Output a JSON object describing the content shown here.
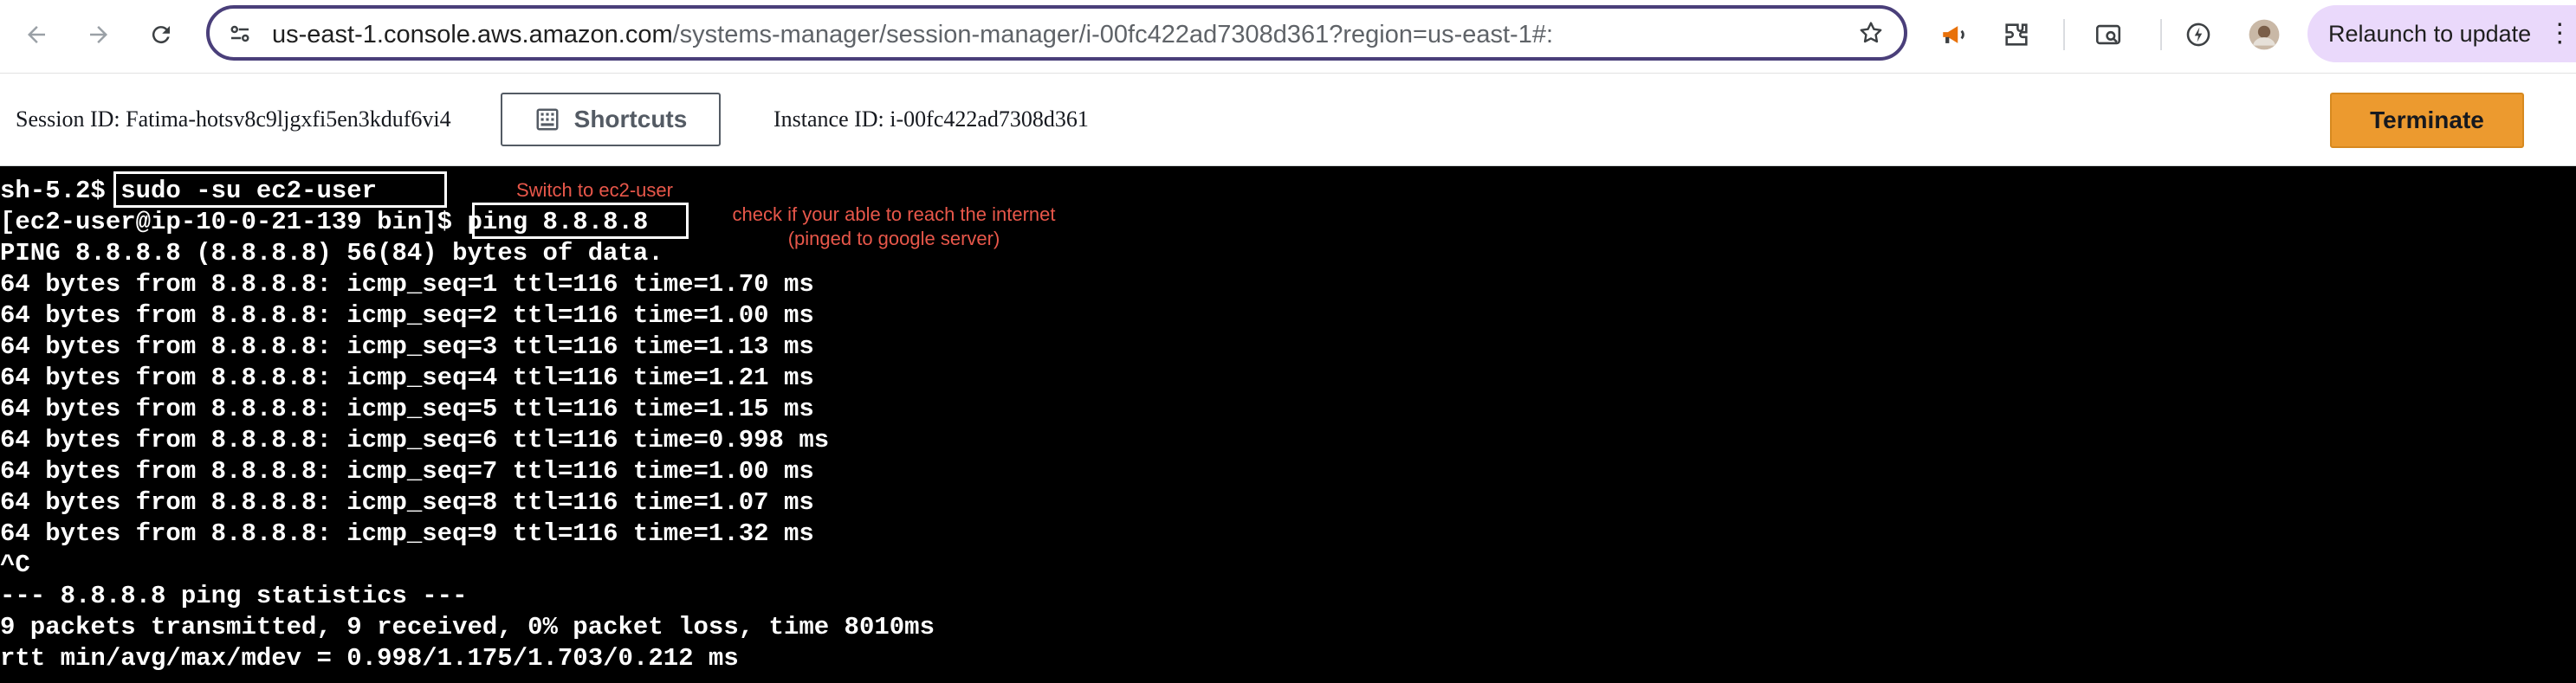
{
  "browser": {
    "url_host": "us-east-1.console.aws.amazon.com",
    "url_path": "/systems-manager/session-manager/i-00fc422ad7308d361?region=us-east-1#:",
    "relaunch_label": "Relaunch to update",
    "icons": [
      "back-icon",
      "forward-icon",
      "reload-icon",
      "site-info-icon",
      "bookmark-star-icon",
      "megaphone-icon",
      "extensions-icon",
      "tab-search-icon",
      "performance-icon",
      "profile-avatar",
      "more-menu-icon"
    ]
  },
  "session": {
    "session_id": "Session ID: Fatima-hotsv8c9ljgxfi5en3kduf6vi4",
    "shortcuts_label": "Shortcuts",
    "instance_id": "Instance ID: i-00fc422ad7308d361",
    "terminate_label": "Terminate"
  },
  "terminal": {
    "lines": [
      "sh-5.2$ sudo -su ec2-user",
      "[ec2-user@ip-10-0-21-139 bin]$ ping 8.8.8.8",
      "PING 8.8.8.8 (8.8.8.8) 56(84) bytes of data.",
      "64 bytes from 8.8.8.8: icmp_seq=1 ttl=116 time=1.70 ms",
      "64 bytes from 8.8.8.8: icmp_seq=2 ttl=116 time=1.00 ms",
      "64 bytes from 8.8.8.8: icmp_seq=3 ttl=116 time=1.13 ms",
      "64 bytes from 8.8.8.8: icmp_seq=4 ttl=116 time=1.21 ms",
      "64 bytes from 8.8.8.8: icmp_seq=5 ttl=116 time=1.15 ms",
      "64 bytes from 8.8.8.8: icmp_seq=6 ttl=116 time=0.998 ms",
      "64 bytes from 8.8.8.8: icmp_seq=7 ttl=116 time=1.00 ms",
      "64 bytes from 8.8.8.8: icmp_seq=8 ttl=116 time=1.07 ms",
      "64 bytes from 8.8.8.8: icmp_seq=9 ttl=116 time=1.32 ms",
      "^C",
      "--- 8.8.8.8 ping statistics ---",
      "9 packets transmitted, 9 received, 0% packet loss, time 8010ms",
      "rtt min/avg/max/mdev = 0.998/1.175/1.703/0.212 ms"
    ]
  },
  "annotations": {
    "switch_user": "Switch to ec2-user",
    "internet_check_line1": "check if your able to reach the internet",
    "internet_check_line2": "(pinged to google server)"
  },
  "colors": {
    "terminate": "#ec9a2f",
    "annotation": "#e8574a",
    "relaunch_bg": "#ead9fb",
    "omnibox_border": "#4a3f7a"
  }
}
